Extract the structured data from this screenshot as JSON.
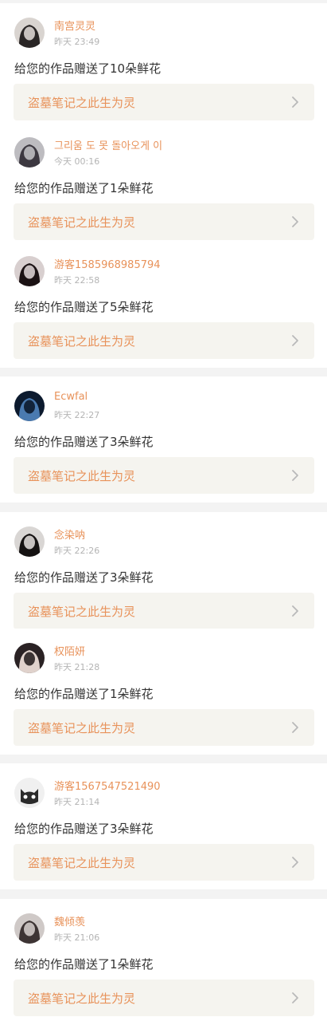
{
  "items": [
    {
      "username": "南宫灵灵",
      "time": "昨天 23:49",
      "message": "给您的作品赠送了10朵鲜花",
      "work_title": "盗墓笔记之此生为灵",
      "avatar_icon": "user-avatar-icon",
      "avatar_bg": "#d9d4d0",
      "avatar_fg": "#2a2626"
    },
    {
      "username": "그리움 도 못 돌아오게 이",
      "time": "今天 00:16",
      "message": "给您的作品赠送了1朵鲜花",
      "work_title": "盗墓笔记之此生为灵",
      "avatar_icon": "user-avatar-icon",
      "avatar_bg": "#bdbcc0",
      "avatar_fg": "#3c3840"
    },
    {
      "username": "游客1585968985794",
      "time": "昨天 22:58",
      "message": "给您的作品赠送了5朵鲜花",
      "work_title": "盗墓笔记之此生为灵",
      "avatar_icon": "user-avatar-icon",
      "avatar_bg": "#d8cfcf",
      "avatar_fg": "#1b1214"
    },
    {
      "username": "Ecwfal",
      "time": "昨天 22:27",
      "message": "给您的作品赠送了3朵鲜花",
      "work_title": "盗墓笔记之此生为灵",
      "avatar_icon": "user-avatar-icon",
      "avatar_bg": "#0c1a2e",
      "avatar_fg": "#4a7ab0"
    },
    {
      "username": "念染呐",
      "time": "昨天 22:26",
      "message": "给您的作品赠送了3朵鲜花",
      "work_title": "盗墓笔记之此生为灵",
      "avatar_icon": "user-avatar-icon",
      "avatar_bg": "#d9d6d4",
      "avatar_fg": "#151212"
    },
    {
      "username": "权陌妍",
      "time": "昨天 21:28",
      "message": "给您的作品赠送了1朵鲜花",
      "work_title": "盗墓笔记之此生为灵",
      "avatar_icon": "user-avatar-icon",
      "avatar_bg": "#2a2224",
      "avatar_fg": "#e0d2cc"
    },
    {
      "username": "游客1567547521490",
      "time": "昨天 21:14",
      "message": "给您的作品赠送了3朵鲜花",
      "work_title": "盗墓笔记之此生为灵",
      "avatar_icon": "cat-avatar-icon",
      "avatar_bg": "#f0f0f0",
      "avatar_fg": "#2b2b2b"
    },
    {
      "username": "魏倾羡",
      "time": "昨天 21:06",
      "message": "给您的作品赠送了1朵鲜花",
      "work_title": "盗墓笔记之此生为灵",
      "avatar_icon": "user-avatar-icon",
      "avatar_bg": "#cfc9c7",
      "avatar_fg": "#3d3434"
    }
  ],
  "colors": {
    "accent": "#e8925a",
    "meta": "#b4b4b4",
    "text": "#333333",
    "card_bg": "#f5f4ef",
    "separator": "#f3f3f3"
  }
}
